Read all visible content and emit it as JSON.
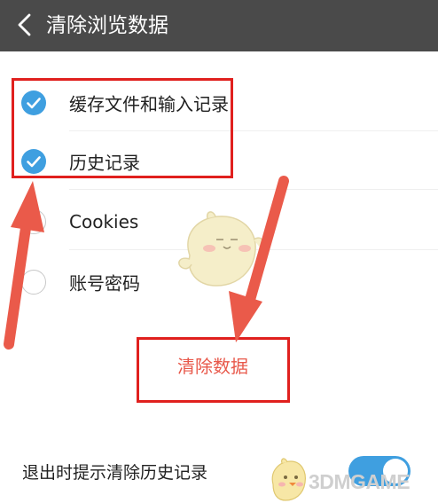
{
  "header": {
    "title": "清除浏览数据",
    "back_icon": "chevron-left-icon"
  },
  "options": [
    {
      "label": "缓存文件和输入记录",
      "checked": true
    },
    {
      "label": "历史记录",
      "checked": true
    },
    {
      "label": "Cookies",
      "checked": false
    },
    {
      "label": "账号密码",
      "checked": false
    }
  ],
  "clear_button": {
    "label": "清除数据"
  },
  "footer": {
    "exit_prompt_label": "退出时提示清除历史记录",
    "exit_prompt_enabled": true
  },
  "watermark": {
    "text": "3DMGAME"
  },
  "colors": {
    "header_bg": "#4a4a4a",
    "accent": "#3f9fe0",
    "danger_text": "#e8584a",
    "annotation": "#e0201e"
  }
}
